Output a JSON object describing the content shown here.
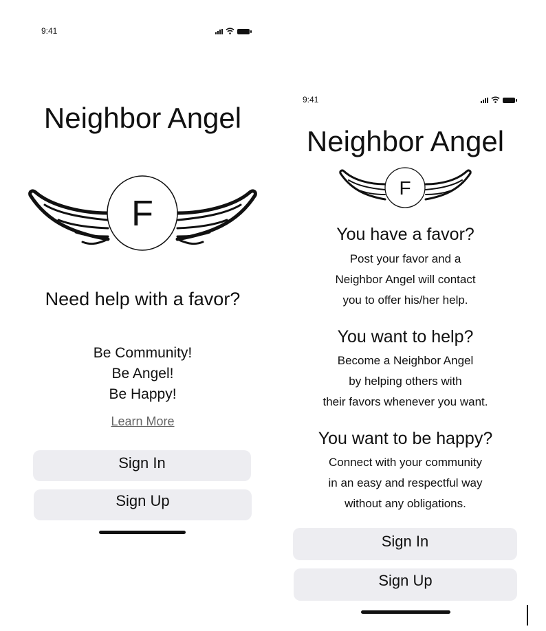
{
  "left_screen": {
    "status_time": "9:41",
    "app_title": "Neighbor Angel",
    "logo_letter": "F",
    "headline": "Need help with a favor?",
    "taglines": [
      "Be Community!",
      "Be Angel!",
      "Be Happy!"
    ],
    "learn_more": "Learn More",
    "sign_in": "Sign In",
    "sign_up": "Sign Up"
  },
  "right_screen": {
    "status_time": "9:41",
    "app_title": "Neighbor Angel",
    "logo_letter": "F",
    "sections": [
      {
        "heading": "You have a favor?",
        "lines": [
          "Post your favor and a",
          "Neighbor Angel will contact",
          "you to offer his/her help."
        ]
      },
      {
        "heading": "You want to help?",
        "lines": [
          "Become a Neighbor Angel",
          "by helping others with",
          "their favors whenever you want."
        ]
      },
      {
        "heading": "You want to be happy?",
        "lines": [
          "Connect with your community",
          "in an easy and respectful way",
          "without any obligations."
        ]
      }
    ],
    "sign_in": "Sign In",
    "sign_up": "Sign Up"
  }
}
